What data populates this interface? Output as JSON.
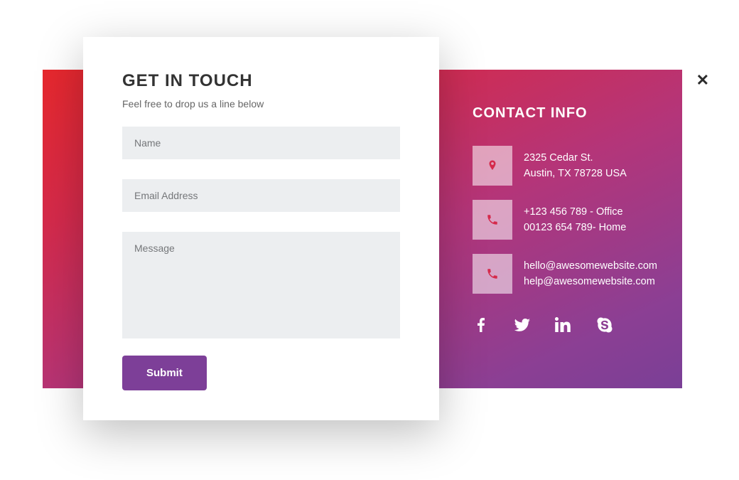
{
  "form": {
    "title": "GET IN TOUCH",
    "subtitle": "Feel free to drop us a line below",
    "name_placeholder": "Name",
    "email_placeholder": "Email Address",
    "message_placeholder": "Message",
    "submit_label": "Submit"
  },
  "contact": {
    "title": "CONTACT INFO",
    "address_line1": "2325 Cedar St.",
    "address_line2": "Austin, TX 78728 USA",
    "phone_line1": "+123 456 789 - Office",
    "phone_line2": "00123 654 789- Home",
    "email_line1": "hello@awesomewebsite.com",
    "email_line2": "help@awesomewebsite.com"
  },
  "close_glyph": "✕"
}
